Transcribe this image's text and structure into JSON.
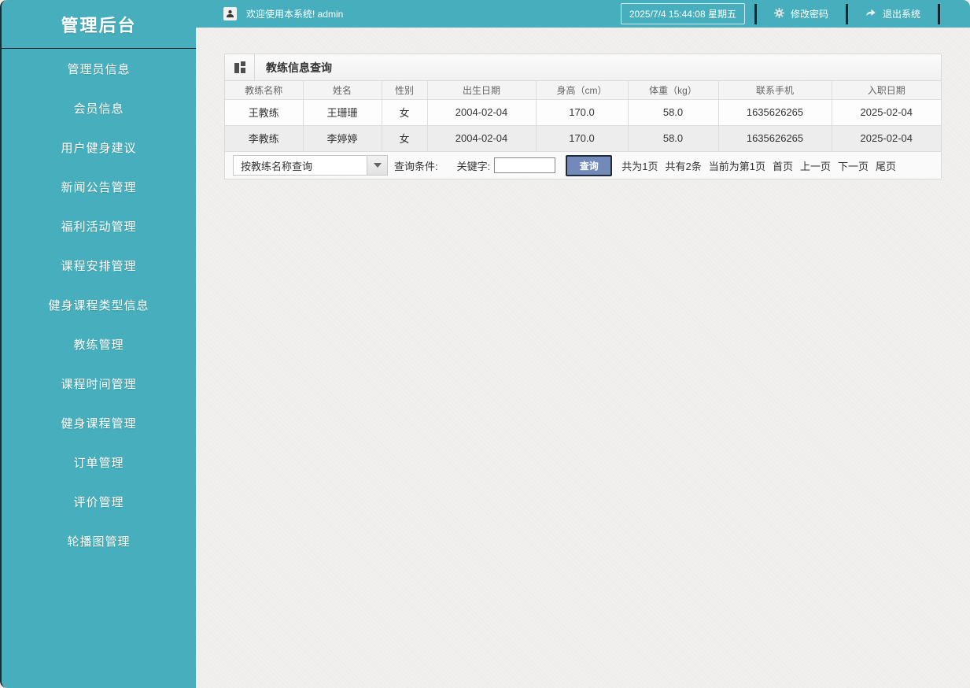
{
  "app": {
    "title": "管理后台"
  },
  "topbar": {
    "welcome": "欢迎使用本系统! admin",
    "datetime": "2025/7/4 15:44:08 星期五",
    "change_password": "修改密码",
    "logout": "退出系统"
  },
  "sidebar": {
    "items": [
      {
        "label": "管理员信息"
      },
      {
        "label": "会员信息"
      },
      {
        "label": "用户健身建议"
      },
      {
        "label": "新闻公告管理"
      },
      {
        "label": "福利活动管理"
      },
      {
        "label": "课程安排管理"
      },
      {
        "label": "健身课程类型信息"
      },
      {
        "label": "教练管理"
      },
      {
        "label": "课程时间管理"
      },
      {
        "label": "健身课程管理"
      },
      {
        "label": "订单管理"
      },
      {
        "label": "评价管理"
      },
      {
        "label": "轮播图管理"
      }
    ]
  },
  "panel": {
    "title": "教练信息查询",
    "table": {
      "columns": [
        "教练名称",
        "姓名",
        "性别",
        "出生日期",
        "身高（cm）",
        "体重（kg）",
        "联系手机",
        "入职日期"
      ],
      "rows": [
        [
          "王教练",
          "王珊珊",
          "女",
          "2004-02-04",
          "170.0",
          "58.0",
          "1635626265",
          "2025-02-04"
        ],
        [
          "李教练",
          "李婷婷",
          "女",
          "2004-02-04",
          "170.0",
          "58.0",
          "1635626265",
          "2025-02-04"
        ]
      ]
    },
    "query": {
      "select_value": "按教练名称查询",
      "condition_label": "查询条件:",
      "keyword_label": "关键字:",
      "keyword_value": "",
      "search_button": "查询"
    },
    "pagination": {
      "total_pages": "共为1页",
      "total_records": "共有2条",
      "current_page": "当前为第1页",
      "first": "首页",
      "prev": "上一页",
      "next": "下一页",
      "last": "尾页"
    }
  },
  "colors": {
    "sidebar_teal": "#46aebc",
    "topbar_divider": "#16242e",
    "search_button_blue": "#7289ba",
    "search_button_border": "#1e2b3d"
  }
}
